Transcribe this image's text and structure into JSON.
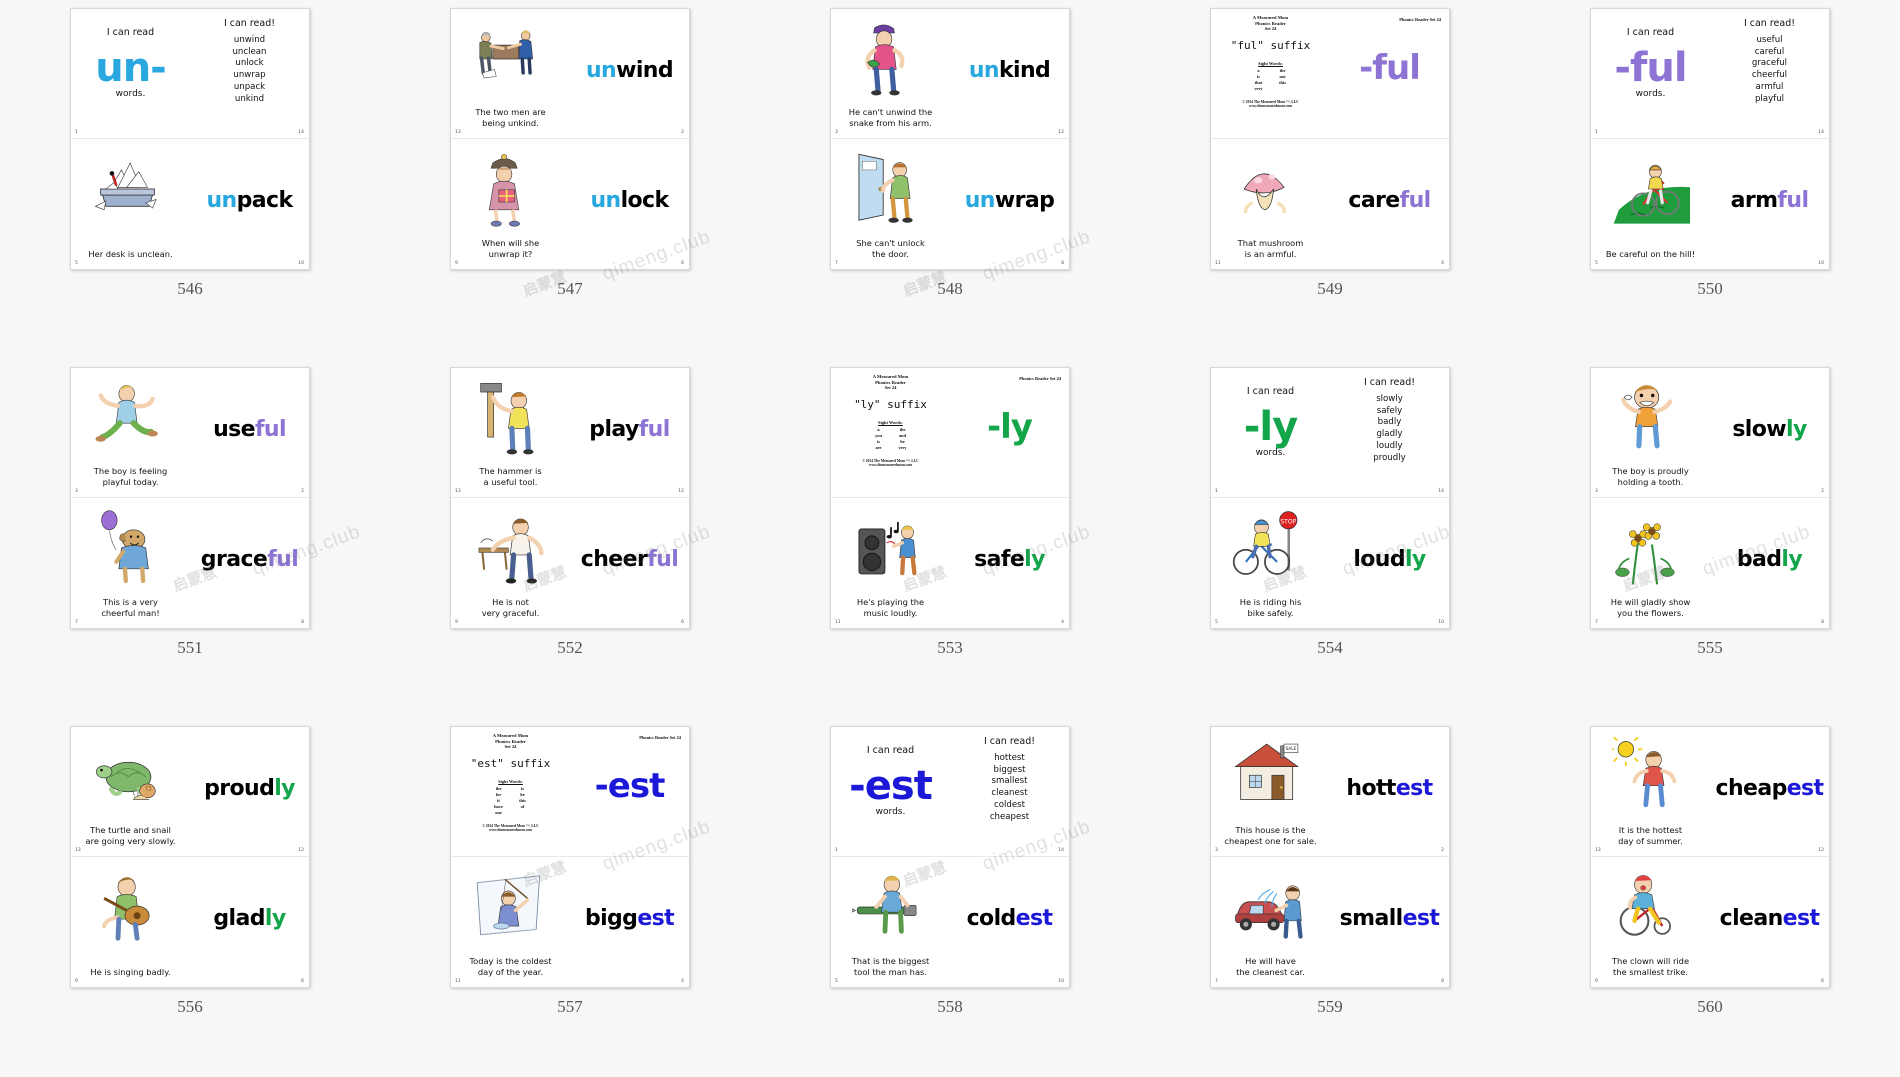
{
  "watermark": {
    "latin": "qimeng.club",
    "cjk": "启蒙慧"
  },
  "reader_meta": {
    "publisher_line": "A Measured Mom\nPhonics Reader\nSet 24",
    "publisher_l1": "A Measured Mom",
    "publisher_l2": "Phonics Reader",
    "publisher_l3": "Set 24",
    "sight_words_header": "Sight Words:",
    "copyright_l1": "© 2014 The Measured Mom ™, LLC",
    "copyright_l2": "www.themeasuredmom.com",
    "set_label": "Phonics Reader Set 24"
  },
  "labels": {
    "i_can_read": "I can read",
    "i_can_read_excl": "I can read!",
    "words": "words."
  },
  "colors": {
    "un_blue": "#29a8e0",
    "ful_purple": "#8d74d4",
    "ly_green": "#12a54a",
    "est_blue": "#1c18d8",
    "black": "#000000"
  },
  "cards": [
    {
      "index": "546",
      "suffix": "un-",
      "accent": "#29a8e0",
      "pages": [
        {
          "kind": "cover",
          "title": "I can read",
          "suffix": "un-",
          "words_label": "words.",
          "pagenum": "1"
        },
        {
          "kind": "wordlist",
          "header": "I can read!",
          "words": [
            "unwind",
            "unclean",
            "unlock",
            "unwrap",
            "unpack",
            "unkind"
          ],
          "pagenum": "14"
        },
        {
          "kind": "art-right",
          "art": "messy-desk",
          "word_prefix": "un",
          "word_rest": "pack",
          "caption": "Her desk is unclean.",
          "pagenum": "5"
        },
        {
          "kind": "word-only",
          "word_prefix": "un",
          "word_rest": "pack",
          "pagenum": "10"
        }
      ]
    },
    {
      "index": "547",
      "suffix": "un-",
      "accent": "#29a8e0",
      "pages": [
        {
          "kind": "art-left",
          "art": "two-men",
          "caption": "The two men are\nbeing unkind.",
          "pagenum": "13"
        },
        {
          "kind": "word-only",
          "word_prefix": "un",
          "word_rest": "wind",
          "pagenum": "2"
        },
        {
          "kind": "art-left",
          "art": "woman-gift",
          "caption": "When will she\nunwrap it?",
          "pagenum": "9"
        },
        {
          "kind": "word-only",
          "word_prefix": "un",
          "word_rest": "lock",
          "pagenum": "6"
        }
      ]
    },
    {
      "index": "548",
      "suffix": "un-",
      "accent": "#29a8e0",
      "pages": [
        {
          "kind": "art-left",
          "art": "boy-snake",
          "caption": "He can't unwind the\nsnake from his arm.",
          "pagenum": "3"
        },
        {
          "kind": "word-only",
          "word_prefix": "un",
          "word_rest": "kind",
          "pagenum": "12"
        },
        {
          "kind": "art-left",
          "art": "boy-door",
          "caption": "She can't unlock\nthe door.",
          "pagenum": "7"
        },
        {
          "kind": "word-only",
          "word_prefix": "un",
          "word_rest": "wrap",
          "pagenum": "8"
        }
      ]
    },
    {
      "index": "549",
      "suffix": "-ful",
      "accent": "#8d74d4",
      "pages": [
        {
          "kind": "title",
          "suffix_title": "\"ful\" suffix",
          "sight_words": [
            [
              "a",
              "the"
            ],
            [
              "is",
              "not"
            ],
            [
              "that",
              "this"
            ],
            [
              "very",
              ""
            ]
          ],
          "pagenum": ""
        },
        {
          "kind": "suffix-big",
          "suffix": "-ful",
          "set_label": "Phonics Reader Set 24",
          "pagenum": ""
        },
        {
          "kind": "art-left",
          "art": "mushroom",
          "caption": "That mushroom\nis an armful.",
          "pagenum": "11"
        },
        {
          "kind": "word-only",
          "word_prefix": "care",
          "word_rest": "ful",
          "suffix_colored": true,
          "pagenum": "4"
        }
      ]
    },
    {
      "index": "550",
      "suffix": "-ful",
      "accent": "#8d74d4",
      "pages": [
        {
          "kind": "cover",
          "title": "I can read",
          "suffix": "-ful",
          "words_label": "words.",
          "pagenum": "1"
        },
        {
          "kind": "wordlist",
          "header": "I can read!",
          "words": [
            "useful",
            "careful",
            "graceful",
            "cheerful",
            "armful",
            "playful"
          ],
          "pagenum": "14"
        },
        {
          "kind": "art-left",
          "art": "bike-hill",
          "caption": "Be careful on the hill!",
          "pagenum": "5"
        },
        {
          "kind": "word-only",
          "word_prefix": "arm",
          "word_rest": "ful",
          "suffix_colored": true,
          "pagenum": "10"
        }
      ]
    },
    {
      "index": "551",
      "suffix": "-ful",
      "accent": "#8d74d4",
      "pages": [
        {
          "kind": "art-left",
          "art": "boy-jumping",
          "caption": "The boy is feeling\nplayful today.",
          "pagenum": "3"
        },
        {
          "kind": "word-only",
          "word_prefix": "use",
          "word_rest": "ful",
          "suffix_colored": true,
          "pagenum": "2"
        },
        {
          "kind": "art-left",
          "art": "dog-balloon",
          "caption": "This is a very\ncheerful man!",
          "pagenum": "7"
        },
        {
          "kind": "word-only",
          "word_prefix": "grace",
          "word_rest": "ful",
          "suffix_colored": true,
          "pagenum": "8"
        }
      ]
    },
    {
      "index": "552",
      "suffix": "-ful",
      "accent": "#8d74d4",
      "pages": [
        {
          "kind": "art-left",
          "art": "hammer-man",
          "caption": "The hammer is\na useful tool.",
          "pagenum": "13"
        },
        {
          "kind": "word-only",
          "word_prefix": "play",
          "word_rest": "ful",
          "suffix_colored": true,
          "pagenum": "12"
        },
        {
          "kind": "art-left",
          "art": "clumsy-man",
          "caption": "He is not\nvery graceful.",
          "pagenum": "9"
        },
        {
          "kind": "word-only",
          "word_prefix": "cheer",
          "word_rest": "ful",
          "suffix_colored": true,
          "pagenum": "6"
        }
      ]
    },
    {
      "index": "553",
      "suffix": "-ly",
      "accent": "#12a54a",
      "pages": [
        {
          "kind": "title",
          "suffix_title": "\"ly\" suffix",
          "sight_words": [
            [
              "a",
              "the"
            ],
            [
              "you",
              "and"
            ],
            [
              "is",
              "he"
            ],
            [
              "are",
              "very"
            ]
          ],
          "pagenum": ""
        },
        {
          "kind": "suffix-big",
          "suffix": "-ly",
          "set_label": "Phonics Reader Set 24",
          "pagenum": ""
        },
        {
          "kind": "art-left",
          "art": "speaker-music",
          "caption": "He's playing the\nmusic loudly.",
          "pagenum": "11"
        },
        {
          "kind": "word-only",
          "word_prefix": "safe",
          "word_rest": "ly",
          "suffix_colored": true,
          "pagenum": "4"
        }
      ]
    },
    {
      "index": "554",
      "suffix": "-ly",
      "accent": "#12a54a",
      "pages": [
        {
          "kind": "cover",
          "title": "I can read",
          "suffix": "-ly",
          "words_label": "words.",
          "pagenum": "1"
        },
        {
          "kind": "wordlist",
          "header": "I can read!",
          "words": [
            "slowly",
            "safely",
            "badly",
            "gladly",
            "loudly",
            "proudly"
          ],
          "pagenum": "14"
        },
        {
          "kind": "art-left",
          "art": "bike-stop",
          "caption": "He is riding his\nbike safely.",
          "pagenum": "5"
        },
        {
          "kind": "word-only",
          "word_prefix": "loud",
          "word_rest": "ly",
          "suffix_colored": true,
          "pagenum": "10"
        }
      ]
    },
    {
      "index": "555",
      "suffix": "-ly",
      "accent": "#12a54a",
      "pages": [
        {
          "kind": "art-left",
          "art": "boy-tooth",
          "caption": "The boy is proudly\nholding a tooth.",
          "pagenum": "3"
        },
        {
          "kind": "word-only",
          "word_prefix": "slow",
          "word_rest": "ly",
          "suffix_colored": true,
          "pagenum": "2"
        },
        {
          "kind": "art-left",
          "art": "girl-flowers",
          "caption": "He will gladly show\nyou the flowers.",
          "pagenum": "7"
        },
        {
          "kind": "word-only",
          "word_prefix": "bad",
          "word_rest": "ly",
          "suffix_colored": true,
          "pagenum": "8"
        }
      ]
    },
    {
      "index": "556",
      "suffix": "-ly",
      "accent": "#12a54a",
      "pages": [
        {
          "kind": "art-left",
          "art": "turtle-snail",
          "caption": "The turtle and snail\nare going very slowly.",
          "pagenum": "13"
        },
        {
          "kind": "word-only",
          "word_prefix": "proud",
          "word_rest": "ly",
          "suffix_colored": true,
          "pagenum": "12"
        },
        {
          "kind": "art-left",
          "art": "guitar-boy",
          "caption": "He is singing badly.",
          "pagenum": "9"
        },
        {
          "kind": "word-only",
          "word_prefix": "glad",
          "word_rest": "ly",
          "suffix_colored": true,
          "pagenum": "6"
        }
      ]
    },
    {
      "index": "557",
      "suffix": "-est",
      "accent": "#1c18d8",
      "pages": [
        {
          "kind": "title",
          "suffix_title": "\"est\" suffix",
          "sight_words": [
            [
              "the",
              "is"
            ],
            [
              "for",
              "he"
            ],
            [
              "it",
              "this"
            ],
            [
              "have",
              "of"
            ],
            [
              "one",
              ""
            ]
          ],
          "pagenum": ""
        },
        {
          "kind": "suffix-big",
          "suffix": "-est",
          "set_label": "Phonics Reader Set 24",
          "pagenum": ""
        },
        {
          "kind": "art-left",
          "art": "ice-fishing",
          "caption": "Today is the coldest\nday of the year.",
          "pagenum": "11"
        },
        {
          "kind": "word-only",
          "word_prefix": "bigg",
          "word_rest": "est",
          "suffix_colored": true,
          "pagenum": "4"
        }
      ]
    },
    {
      "index": "558",
      "suffix": "-est",
      "accent": "#1c18d8",
      "pages": [
        {
          "kind": "cover",
          "title": "I can read",
          "suffix": "-est",
          "words_label": "words.",
          "pagenum": "1"
        },
        {
          "kind": "wordlist",
          "header": "I can read!",
          "words": [
            "hottest",
            "biggest",
            "smallest",
            "cleanest",
            "coldest",
            "cheapest"
          ],
          "pagenum": "14"
        },
        {
          "kind": "art-left",
          "art": "boy-tool",
          "caption": "That is the biggest\ntool the man has.",
          "pagenum": "5"
        },
        {
          "kind": "word-only",
          "word_prefix": "cold",
          "word_rest": "est",
          "suffix_colored": true,
          "pagenum": "10"
        }
      ]
    },
    {
      "index": "559",
      "suffix": "-est",
      "accent": "#1c18d8",
      "pages": [
        {
          "kind": "art-left",
          "art": "house-sale",
          "caption": "This house is the\ncheapest one for sale.",
          "pagenum": "3"
        },
        {
          "kind": "word-only",
          "word_prefix": "hott",
          "word_rest": "est",
          "suffix_colored": true,
          "pagenum": "2"
        },
        {
          "kind": "art-left",
          "art": "car-wash",
          "caption": "He will have\nthe cleanest car.",
          "pagenum": "7"
        },
        {
          "kind": "word-only",
          "word_prefix": "small",
          "word_rest": "est",
          "suffix_colored": true,
          "pagenum": "8"
        }
      ]
    },
    {
      "index": "560",
      "suffix": "-est",
      "accent": "#1c18d8",
      "pages": [
        {
          "kind": "art-left",
          "art": "sun-boy",
          "caption": "It is the hottest\nday of summer.",
          "pagenum": "13"
        },
        {
          "kind": "word-only",
          "word_prefix": "cheap",
          "word_rest": "est",
          "suffix_colored": true,
          "pagenum": "12"
        },
        {
          "kind": "art-left",
          "art": "clown-trike",
          "caption": "The clown will ride\nthe smallest trike.",
          "pagenum": "9"
        },
        {
          "kind": "word-only",
          "word_prefix": "clean",
          "word_rest": "est",
          "suffix_colored": true,
          "pagenum": "6"
        }
      ]
    }
  ]
}
